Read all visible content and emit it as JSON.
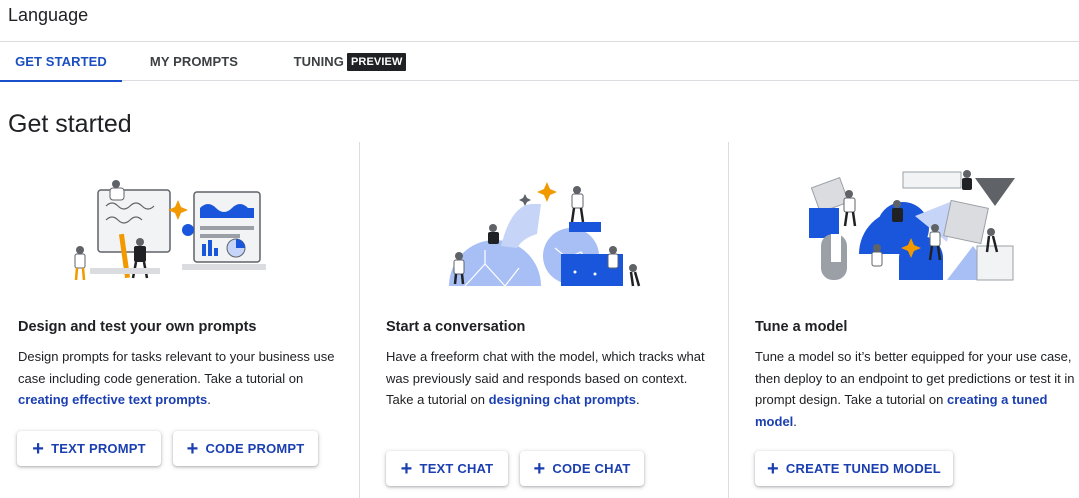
{
  "app": {
    "title": "Language"
  },
  "tabs": [
    {
      "label": "GET STARTED",
      "active": true
    },
    {
      "label": "MY PROMPTS",
      "active": false
    },
    {
      "label": "TUNING",
      "badge": "PREVIEW",
      "active": false
    }
  ],
  "page": {
    "title": "Get started"
  },
  "cards": [
    {
      "title": "Design and test your own prompts",
      "desc_before": "Design prompts for tasks relevant to your business use case including code generation. Take a tutorial on ",
      "link": "creating effective text prompts",
      "desc_after": ".",
      "buttons": [
        "TEXT PROMPT",
        "CODE PROMPT"
      ]
    },
    {
      "title": "Start a conversation",
      "desc_before": "Have a freeform chat with the model, which tracks what was previously said and responds based on context. Take a tutorial on ",
      "link": "designing chat prompts",
      "desc_after": ".",
      "buttons": [
        "TEXT CHAT",
        "CODE CHAT"
      ]
    },
    {
      "title": "Tune a model",
      "desc_before": "Tune a model so it’s better equipped for your use case, then deploy to an endpoint to get predictions or test it in prompt design. Take a tutorial on ",
      "link": "creating a tuned model",
      "desc_after": ".",
      "buttons": [
        "CREATE TUNED MODEL"
      ]
    }
  ],
  "icons": {
    "plus": "plus-icon"
  },
  "colors": {
    "accent": "#1b3fb0",
    "tab_active": "#1b4fbf",
    "badge_bg": "#202124"
  }
}
